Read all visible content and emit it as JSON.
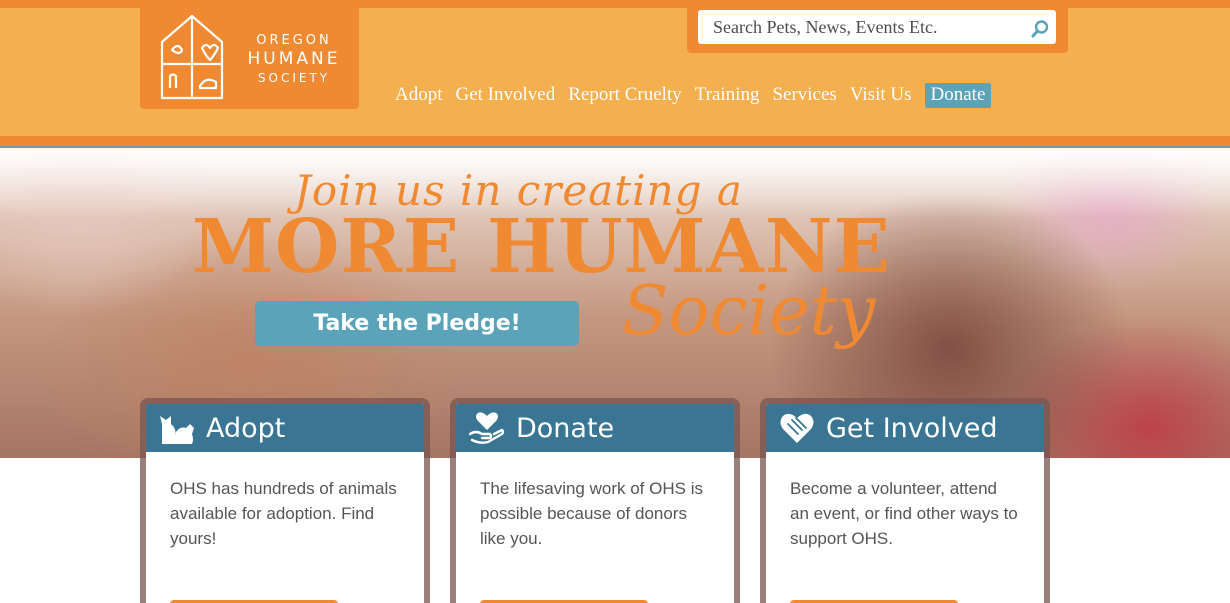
{
  "logo": {
    "line1": "OREGON",
    "line2": "HUMANE",
    "line3": "SOCIETY"
  },
  "search": {
    "placeholder": "Search Pets, News, Events Etc."
  },
  "nav": {
    "items": [
      "Adopt",
      "Get Involved",
      "Report Cruelty",
      "Training",
      "Services",
      "Visit Us"
    ],
    "donate": "Donate"
  },
  "hero": {
    "line1": "Join us in creating a",
    "line2": "MORE HUMANE",
    "line3": "Society",
    "pledge_button": "Take the Pledge!"
  },
  "cards": [
    {
      "title": "Adopt",
      "icon": "cat-dog-icon",
      "body": "OHS has hundreds of animals available for adoption. Find yours!"
    },
    {
      "title": "Donate",
      "icon": "heart-hand-icon",
      "body": "The lifesaving work of OHS is possible because of donors like you."
    },
    {
      "title": "Get Involved",
      "icon": "hands-heart-icon",
      "body": "Become a volunteer, attend an event, or find other ways to support OHS."
    }
  ],
  "colors": {
    "orange": "#ef8a32",
    "light_orange": "#f4b04f",
    "teal": "#5ba3b8",
    "card_blue": "#3a7593"
  }
}
